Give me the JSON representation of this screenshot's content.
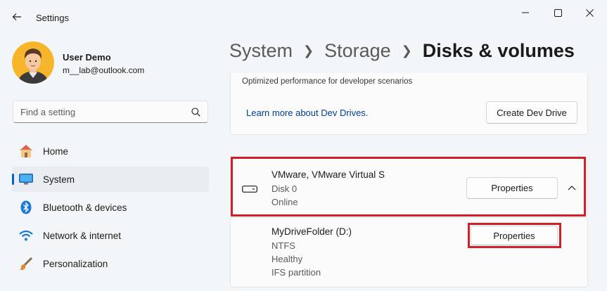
{
  "window": {
    "title": "Settings",
    "back_icon": "back-arrow-icon",
    "minimize_icon": "minimize-icon",
    "maximize_icon": "maximize-icon",
    "close_icon": "close-icon"
  },
  "user": {
    "name": "User Demo",
    "email": "m__lab@outlook.com"
  },
  "search": {
    "placeholder": "Find a setting",
    "icon": "search-icon"
  },
  "sidebar": {
    "items": [
      {
        "label": "Home",
        "icon": "home-icon",
        "active": false
      },
      {
        "label": "System",
        "icon": "system-icon",
        "active": true
      },
      {
        "label": "Bluetooth & devices",
        "icon": "bluetooth-icon",
        "active": false
      },
      {
        "label": "Network & internet",
        "icon": "wifi-icon",
        "active": false
      },
      {
        "label": "Personalization",
        "icon": "brush-icon",
        "active": false
      }
    ],
    "accent": "#0067c0"
  },
  "breadcrumb": {
    "items": [
      "System",
      "Storage",
      "Disks & volumes"
    ]
  },
  "dev_drive": {
    "description": "Optimized performance for developer scenarios",
    "link": "Learn more about Dev Drives.",
    "button": "Create Dev Drive"
  },
  "disk": {
    "name": "VMware, VMware Virtual S",
    "number": "Disk 0",
    "status": "Online",
    "button": "Properties",
    "icon": "disk-drive-icon",
    "expand_icon": "chevron-up-icon"
  },
  "volume": {
    "name": "MyDriveFolder (D:)",
    "filesystem": "NTFS",
    "health": "Healthy",
    "type": "IFS partition",
    "button": "Properties"
  },
  "highlight_color": "#d0202a"
}
